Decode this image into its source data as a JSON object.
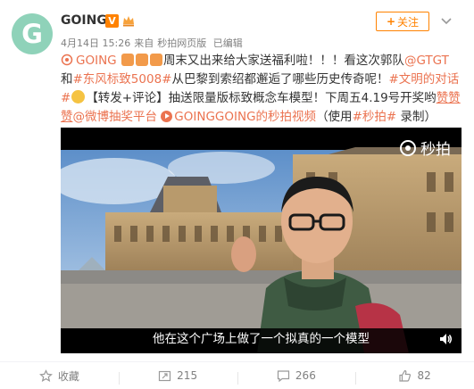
{
  "post": {
    "author": "GOING",
    "avatar_letter": "G",
    "verified_badge": "V",
    "meta": {
      "date": "4月14日 15:26",
      "source_prefix": "来自",
      "source": "秒拍网页版",
      "edited": "已编辑"
    },
    "follow_label": "关注",
    "text": {
      "part1_link": "GOING",
      "part2": "周末又出来给大家送福利啦！！！看这次郭队",
      "mention_gtgt": "@GTGT",
      "part3": " 和",
      "topic1": "#东风标致5008#",
      "part4": "从巴黎到索绍都邂逅了哪些历史传奇呢！",
      "topic2": "#文明的对话#",
      "part5": "【转发+评论】抽送限量版标致概念车模型！下周五4.19号开奖哟",
      "highlight": "赞赞赞",
      "mention_lottery": "@微博抽奖平台",
      "video_link": "GOINGGOING的秒拍视频",
      "part6": "（使用",
      "topic3": "#秒拍#",
      "part7": " 录制）"
    }
  },
  "video": {
    "watermark": "秒拍",
    "subtitle": "他在这个广场上做了一个拟真的一个模型"
  },
  "footer": {
    "favorite_label": "收藏",
    "repost_count": "215",
    "comment_count": "266",
    "like_count": "82"
  },
  "colors": {
    "accent": "#ff8200",
    "link": "#eb7350",
    "avatar_bg": "#8fd2b9"
  }
}
